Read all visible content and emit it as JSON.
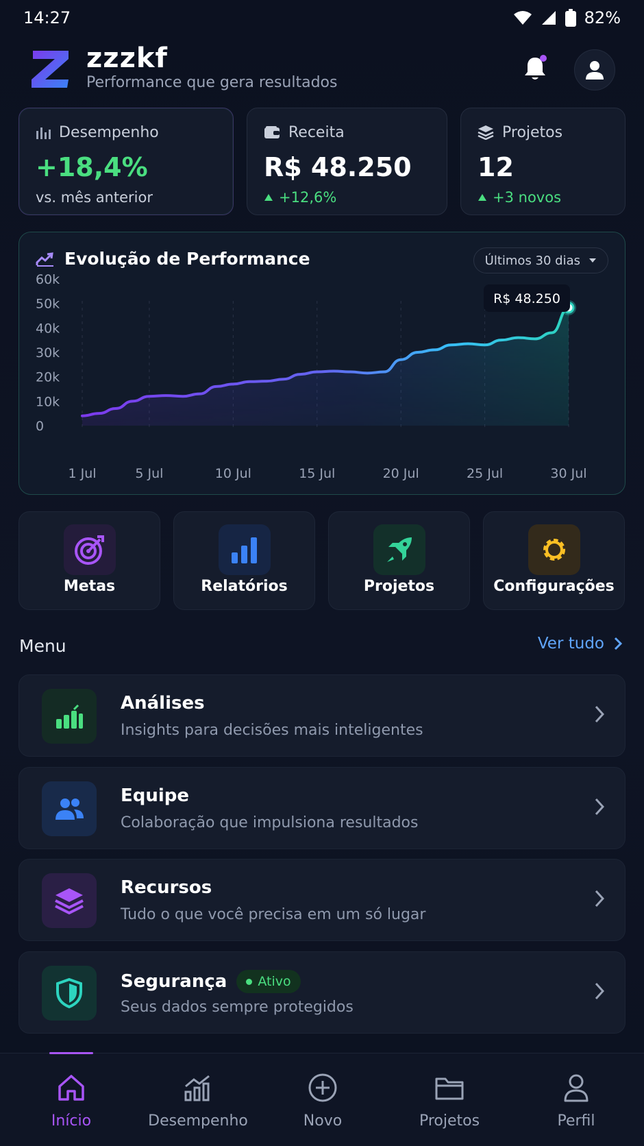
{
  "status": {
    "time": "14:27",
    "battery": "82%"
  },
  "header": {
    "title": "zzzkf",
    "subtitle": "Performance que gera resultados"
  },
  "stats": [
    {
      "label": "Desempenho",
      "value": "+18,4%",
      "sub": "vs. mês anterior"
    },
    {
      "label": "Receita",
      "value": "R$ 48.250",
      "sub": "+12,6%"
    },
    {
      "label": "Projetos",
      "value": "12",
      "sub": "+3 novos"
    }
  ],
  "chart": {
    "range": "Últimos 30 dias"
  },
  "chart_data": {
    "type": "area",
    "title": "Evolução de Performance",
    "x": [
      "1 Jul",
      "2 Jul",
      "3 Jul",
      "4 Jul",
      "5 Jul",
      "6 Jul",
      "7 Jul",
      "8 Jul",
      "9 Jul",
      "10 Jul",
      "11 Jul",
      "12 Jul",
      "13 Jul",
      "14 Jul",
      "15 Jul",
      "16 Jul",
      "17 Jul",
      "18 Jul",
      "19 Jul",
      "20 Jul",
      "21 Jul",
      "22 Jul",
      "23 Jul",
      "24 Jul",
      "25 Jul",
      "26 Jul",
      "27 Jul",
      "28 Jul",
      "29 Jul",
      "30 Jul"
    ],
    "xticks": [
      "1 Jul",
      "5 Jul",
      "10 Jul",
      "15 Jul",
      "20 Jul",
      "25 Jul",
      "30 Jul"
    ],
    "yticks": [
      "0",
      "10k",
      "20k",
      "30k",
      "40k",
      "50k",
      "60k"
    ],
    "series": [
      {
        "values": [
          4,
          5,
          7,
          10,
          12,
          12.3,
          12,
          13,
          16,
          17,
          18,
          18.2,
          19,
          21,
          22,
          22.3,
          22,
          21.5,
          22,
          27,
          30,
          31,
          33,
          33.5,
          33,
          35,
          36,
          35.5,
          38,
          48.25
        ]
      }
    ],
    "ylim": [
      0,
      60
    ],
    "highlight": {
      "label": "R$ 48.250"
    },
    "grid": true
  },
  "quick_actions": [
    "Metas",
    "Relatórios",
    "Projetos",
    "Configurações"
  ],
  "menu": {
    "title": "Menu",
    "see_all": "Ver tudo",
    "items": [
      {
        "title": "Análises",
        "subtitle": "Insights para decisões mais inteligentes"
      },
      {
        "title": "Equipe",
        "subtitle": "Colaboração que impulsiona resultados"
      },
      {
        "title": "Recursos",
        "subtitle": "Tudo o que você precisa em um só lugar"
      },
      {
        "title": "Segurança",
        "subtitle": "Seus dados sempre protegidos",
        "badge": "Ativo"
      }
    ]
  },
  "nav": [
    "Início",
    "Desempenho",
    "Novo",
    "Projetos",
    "Perfil"
  ],
  "colors": {
    "accent": "#a855f7",
    "positive": "#4ade80",
    "link": "#60a5fa",
    "chart_start": "#7c3aed",
    "chart_end": "#2dd4bf"
  }
}
